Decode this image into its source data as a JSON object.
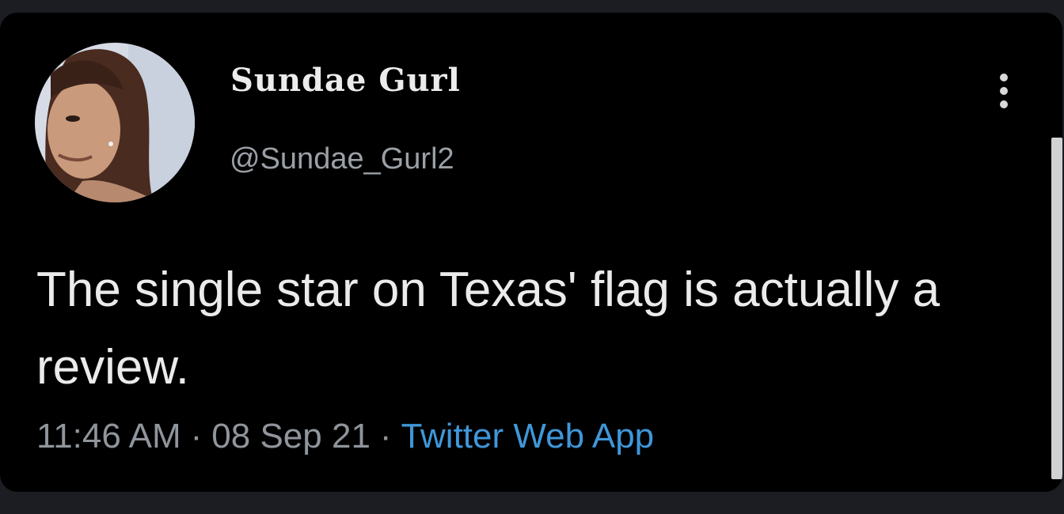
{
  "tweet": {
    "display_name": "Sundae Gurl",
    "handle": "@Sundae_Gurl2",
    "text": "The single star on Texas' flag is actually a review.",
    "time": "11:46 AM",
    "separator": "·",
    "date": "08 Sep 21",
    "source": "Twitter Web App"
  },
  "icons": {
    "more": "more-vertical-icon",
    "avatar": "profile-photo"
  },
  "colors": {
    "card_background": "#000000",
    "page_background": "#1b1d22",
    "text_primary": "#ebebeb",
    "text_secondary": "#8f959b",
    "link": "#3f97d9"
  }
}
